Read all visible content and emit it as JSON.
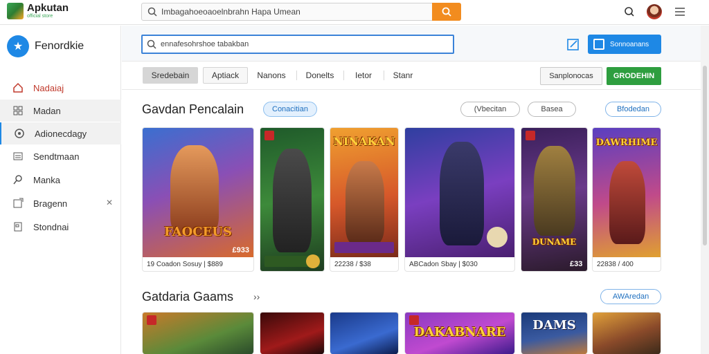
{
  "app": {
    "name": "Apkutan",
    "tagline": "official store"
  },
  "topbar": {
    "search_value": "Imbagahoeoaoelnbrahn Hapa Umean",
    "search_icon": "search-icon",
    "search_button_icon": "search-icon",
    "icons": [
      "search-icon",
      "avatar",
      "menu-icon"
    ]
  },
  "sidebar": {
    "title": "Fenordkie",
    "items": [
      {
        "label": "Nadaiaj",
        "icon": "home-icon"
      },
      {
        "label": "Madan",
        "icon": "grid-icon"
      },
      {
        "label": "Adionecdagy",
        "icon": "circle-icon"
      },
      {
        "label": "Sendtmaan",
        "icon": "list-icon"
      },
      {
        "label": "Manka",
        "icon": "search-icon"
      },
      {
        "label": "Bragenn",
        "icon": "tag-icon",
        "extra": "✕"
      },
      {
        "label": "Stondnai",
        "icon": "doc-icon"
      }
    ]
  },
  "subbar": {
    "search_value": "ennafesohrshoe tabakban",
    "button_label": "Sonnoanans"
  },
  "tabs": {
    "items": [
      "Sredebain",
      "Aptiack",
      "Nanons",
      "Donelts",
      "Ietor",
      "Stanr"
    ],
    "right_buttons": [
      "Sanplonocas",
      "GRODEHIN"
    ]
  },
  "section1": {
    "title": "Gavdan Pencalain",
    "chip": "Conacitian",
    "actions": [
      "(Vbecitan",
      "Basea",
      "Bfodedan"
    ],
    "cards": [
      {
        "art_title": "FAOCEUS",
        "caption": "19 Coadon Sosuy | $889",
        "price_tag": "£933"
      },
      {
        "art_title": "",
        "caption": "",
        "price_tag": ""
      },
      {
        "art_title": "NINAKAN",
        "caption": "22238 / $38",
        "price_tag": ""
      },
      {
        "art_title": "",
        "caption": "ABCadon Sbay | $030",
        "price_tag": ""
      },
      {
        "art_title": "DUNAME",
        "caption": "",
        "price_tag": "£33"
      },
      {
        "art_title": "DAWRHIME",
        "caption": "22838 / 400",
        "price_tag": ""
      }
    ]
  },
  "section2": {
    "title": "Gatdaria Gaams",
    "more": "››",
    "action": "AWAredan",
    "cards": [
      {
        "art_title": ""
      },
      {
        "art_title": ""
      },
      {
        "art_title": ""
      },
      {
        "art_title": "DAKABNARE"
      },
      {
        "art_title": "DAMS"
      },
      {
        "art_title": ""
      }
    ]
  },
  "colors": {
    "accent_orange": "#f28c1f",
    "accent_blue": "#1e88e5",
    "accent_green": "#2e9e3f"
  }
}
